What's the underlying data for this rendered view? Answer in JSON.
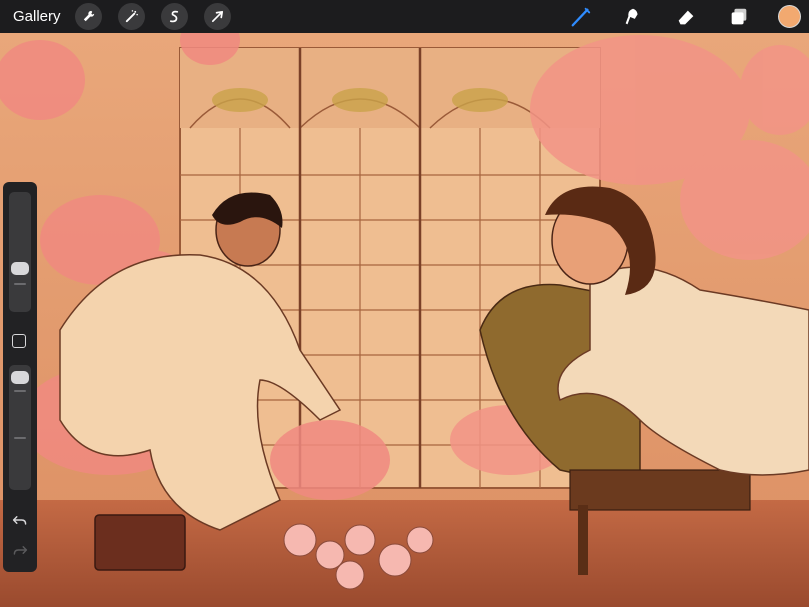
{
  "topbar": {
    "gallery_label": "Gallery",
    "left_tools": [
      {
        "name": "actions",
        "icon": "wrench-icon"
      },
      {
        "name": "adjustments",
        "icon": "magic-wand-icon"
      },
      {
        "name": "selection",
        "icon": "selection-s-icon"
      },
      {
        "name": "transform",
        "icon": "arrow-cursor-icon"
      }
    ],
    "right_tools": [
      {
        "name": "brush",
        "icon": "brush-icon",
        "active": true
      },
      {
        "name": "smudge",
        "icon": "smudge-icon"
      },
      {
        "name": "eraser",
        "icon": "eraser-icon"
      },
      {
        "name": "layers",
        "icon": "layers-icon"
      }
    ],
    "current_color": "#f2a970",
    "active_tool_color": "#2f8cff"
  },
  "sidebar": {
    "brush_size_level": 0.45,
    "opacity_level": 0.9,
    "undo_icon": "undo-icon",
    "redo_icon": "redo-icon"
  },
  "canvas": {
    "description_colors": [
      "#e8a877",
      "#f3c79a",
      "#d8735e",
      "#f08a80",
      "#7a4a2a"
    ]
  }
}
